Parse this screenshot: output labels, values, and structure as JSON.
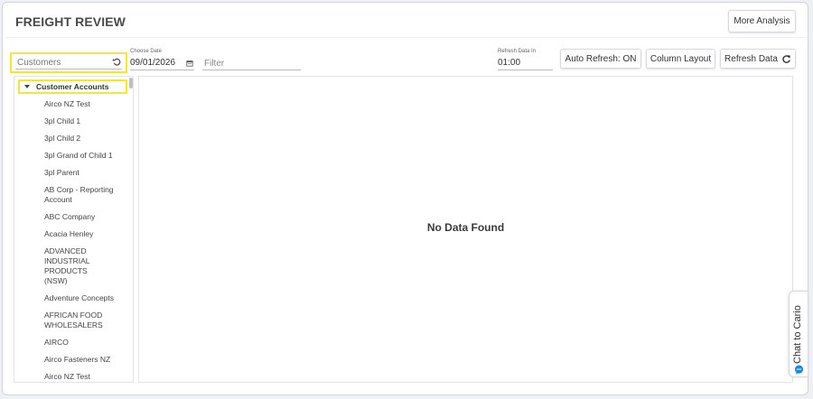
{
  "header": {
    "title": "FREIGHT REVIEW",
    "more_analysis_label": "More Analysis"
  },
  "toolbar": {
    "customers_placeholder": "Customers",
    "choose_date_label": "Choose Date",
    "date_value": "09/01/2026",
    "filter_placeholder": "Filter",
    "refresh_data_in_label": "Refresh Data In",
    "refresh_time": "01:00",
    "auto_refresh_label": "Auto Refresh: ON",
    "column_layout_label": "Column Layout",
    "refresh_data_label": "Refresh Data"
  },
  "tree": {
    "root_label": "Customer Accounts",
    "items": [
      {
        "label": "Airco NZ Test"
      },
      {
        "label": "3pl Child 1"
      },
      {
        "label": "3pl Child 2"
      },
      {
        "label": "3pl Grand of Child 1"
      },
      {
        "label": "3pl Parent"
      },
      {
        "label": "AB Corp - Reporting Account"
      },
      {
        "label": "ABC Company"
      },
      {
        "label": "Acacia Henley"
      },
      {
        "label": "ADVANCED INDUSTRIAL PRODUCTS (NSW)"
      },
      {
        "label": "Adventure Concepts"
      },
      {
        "label": "AFRICAN FOOD WHOLESALERS"
      },
      {
        "label": "AIRCO"
      },
      {
        "label": "Airco Fasteners NZ"
      },
      {
        "label": "Airco NZ Test"
      }
    ]
  },
  "main": {
    "empty_message": "No Data Found"
  },
  "chat": {
    "label": "Chat to Cario"
  },
  "icons": {
    "reset": "reset-icon",
    "calendar": "calendar-icon",
    "refresh": "refresh-icon",
    "tree_toggle": "caret-down-icon",
    "chat": "chat-bubble-icon"
  },
  "colors": {
    "highlight": "#f0e545",
    "chat_icon": "#1e88e5"
  }
}
